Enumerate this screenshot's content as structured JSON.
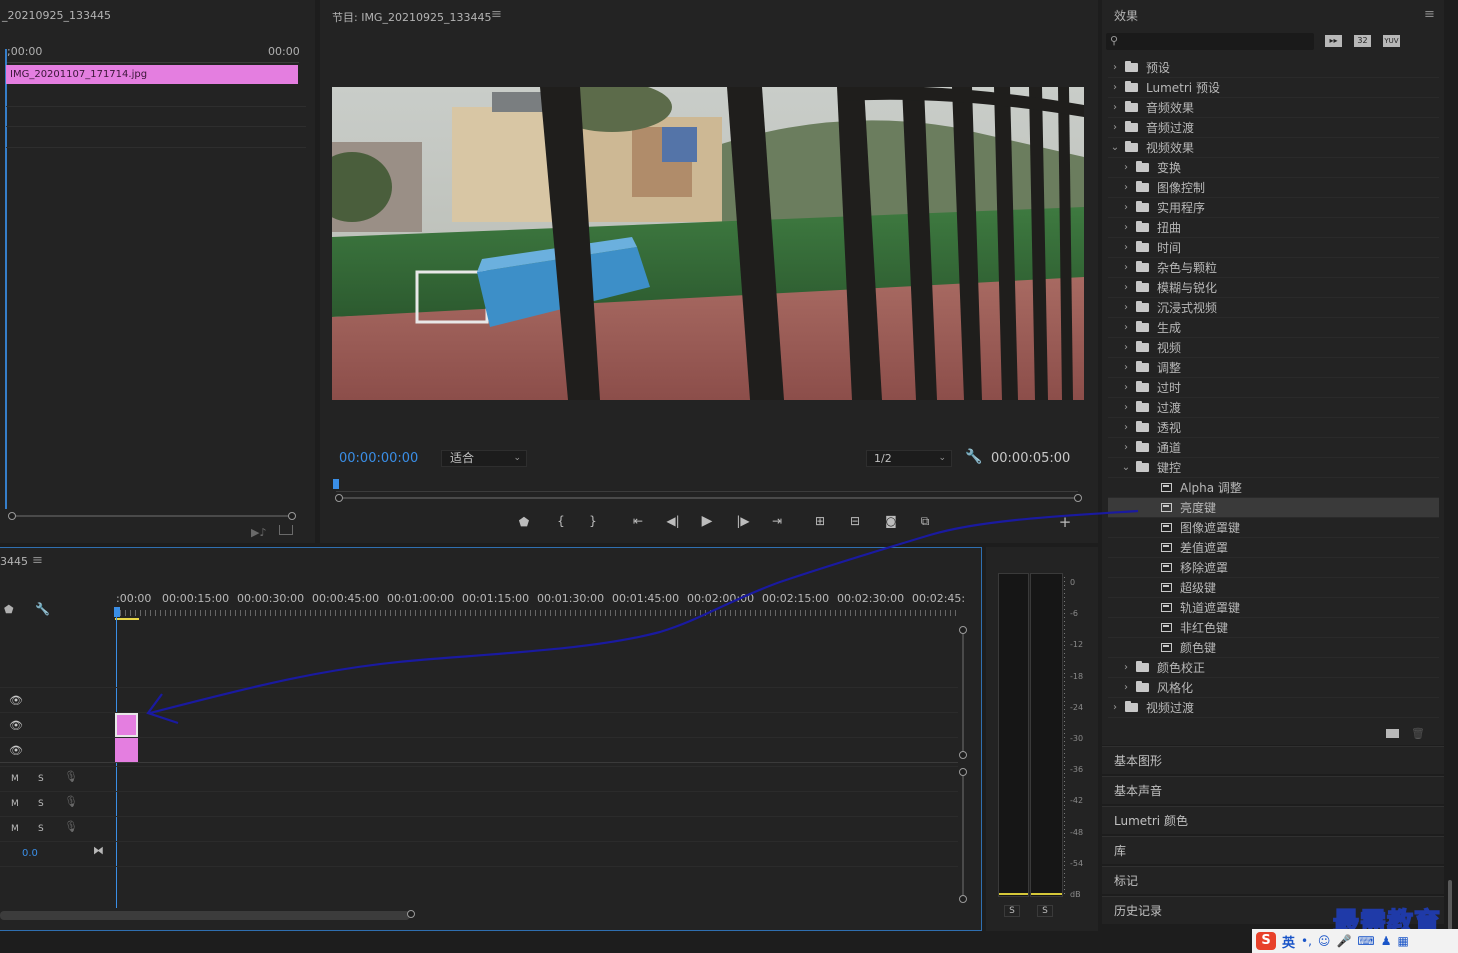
{
  "source_panel": {
    "title": "_20210925_133445",
    "time_start": ";00:00",
    "time_end": "00:00",
    "clip_name": "IMG_20201107_171714.jpg"
  },
  "program_monitor": {
    "title": "节目: IMG_20210925_133445",
    "timecode": "00:00:00:00",
    "fit_label": "适合",
    "resolution_label": "1/2",
    "duration": "00:00:05:00"
  },
  "timeline": {
    "title": "3445",
    "ruler": [
      ":00:00",
      "00:00:15:00",
      "00:00:30:00",
      "00:00:45:00",
      "00:01:00:00",
      "00:01:15:00",
      "00:01:30:00",
      "00:01:45:00",
      "00:02:00:00",
      "00:02:15:00",
      "00:02:30:00",
      "00:02:45:"
    ],
    "audio_tracks": [
      {
        "m": "M",
        "s": "S"
      },
      {
        "m": "M",
        "s": "S"
      },
      {
        "m": "M",
        "s": "S"
      }
    ],
    "master_value": "0.0"
  },
  "meter": {
    "labels": [
      "0",
      "-6",
      "-12",
      "-18",
      "-24",
      "-30",
      "-36",
      "-42",
      "-48",
      "-54",
      "dB"
    ],
    "solo_left": "S",
    "solo_right": "S"
  },
  "effects_panel": {
    "title": "效果",
    "toolbar_icons": [
      "accelerated-icon",
      "32bit-icon",
      "yuv-icon"
    ],
    "toolbar_labels": [
      "32",
      "YUV"
    ],
    "tree": [
      {
        "label": "预设",
        "level": 0,
        "type": "star-folder",
        "open": false
      },
      {
        "label": "Lumetri 预设",
        "level": 0,
        "type": "star-folder",
        "open": false
      },
      {
        "label": "音频效果",
        "level": 0,
        "type": "folder",
        "open": false
      },
      {
        "label": "音频过渡",
        "level": 0,
        "type": "folder",
        "open": false
      },
      {
        "label": "视频效果",
        "level": 0,
        "type": "folder",
        "open": true
      },
      {
        "label": "变换",
        "level": 1,
        "type": "folder",
        "open": false
      },
      {
        "label": "图像控制",
        "level": 1,
        "type": "folder",
        "open": false
      },
      {
        "label": "实用程序",
        "level": 1,
        "type": "folder",
        "open": false
      },
      {
        "label": "扭曲",
        "level": 1,
        "type": "folder",
        "open": false
      },
      {
        "label": "时间",
        "level": 1,
        "type": "folder",
        "open": false
      },
      {
        "label": "杂色与颗粒",
        "level": 1,
        "type": "folder",
        "open": false
      },
      {
        "label": "模糊与锐化",
        "level": 1,
        "type": "folder",
        "open": false
      },
      {
        "label": "沉浸式视频",
        "level": 1,
        "type": "folder",
        "open": false
      },
      {
        "label": "生成",
        "level": 1,
        "type": "folder",
        "open": false
      },
      {
        "label": "视频",
        "level": 1,
        "type": "folder",
        "open": false
      },
      {
        "label": "调整",
        "level": 1,
        "type": "folder",
        "open": false
      },
      {
        "label": "过时",
        "level": 1,
        "type": "folder",
        "open": false
      },
      {
        "label": "过渡",
        "level": 1,
        "type": "folder",
        "open": false
      },
      {
        "label": "透视",
        "level": 1,
        "type": "folder",
        "open": false
      },
      {
        "label": "通道",
        "level": 1,
        "type": "folder",
        "open": false
      },
      {
        "label": "键控",
        "level": 1,
        "type": "folder",
        "open": true
      },
      {
        "label": "Alpha 调整",
        "level": 2,
        "type": "effect"
      },
      {
        "label": "亮度键",
        "level": 2,
        "type": "effect",
        "selected": true
      },
      {
        "label": "图像遮罩键",
        "level": 2,
        "type": "effect"
      },
      {
        "label": "差值遮罩",
        "level": 2,
        "type": "effect"
      },
      {
        "label": "移除遮罩",
        "level": 2,
        "type": "effect"
      },
      {
        "label": "超级键",
        "level": 2,
        "type": "effect"
      },
      {
        "label": "轨道遮罩键",
        "level": 2,
        "type": "effect"
      },
      {
        "label": "非红色键",
        "level": 2,
        "type": "effect"
      },
      {
        "label": "颜色键",
        "level": 2,
        "type": "effect"
      },
      {
        "label": "颜色校正",
        "level": 1,
        "type": "folder",
        "open": false
      },
      {
        "label": "风格化",
        "level": 1,
        "type": "folder",
        "open": false
      },
      {
        "label": "视频过渡",
        "level": 0,
        "type": "folder",
        "open": false
      }
    ]
  },
  "side_panels": [
    "基本图形",
    "基本声音",
    "Lumetri 颜色",
    "库",
    "标记",
    "历史记录"
  ],
  "watermark": "最需教育",
  "ime": {
    "mode": "英"
  },
  "colors": {
    "accent_blue": "#3a8ee6",
    "clip_pink": "#e47ee0",
    "arrow_blue": "#1a1aa0",
    "selected_row": "#3a3a3a"
  }
}
